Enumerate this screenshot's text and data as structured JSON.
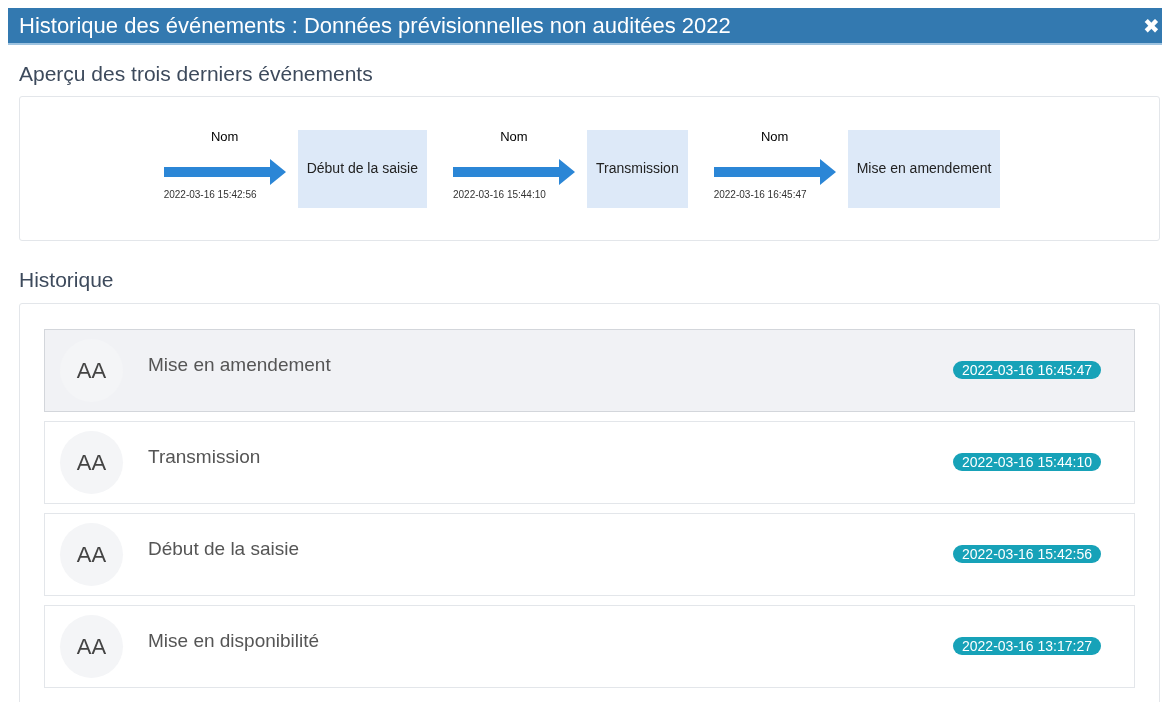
{
  "window": {
    "title": "Historique des événements : Données prévisionnelles non auditées 2022",
    "close": "✖"
  },
  "preview": {
    "heading": "Aperçu des trois derniers événements",
    "steps": [
      {
        "label": "Nom",
        "date": "2022-03-16 15:42:56",
        "event": "Début de la saisie"
      },
      {
        "label": "Nom",
        "date": "2022-03-16 15:44:10",
        "event": "Transmission"
      },
      {
        "label": "Nom",
        "date": "2022-03-16 16:45:47",
        "event": "Mise en amendement"
      }
    ]
  },
  "history": {
    "heading": "Historique",
    "items": [
      {
        "initials": "AA",
        "event": "Mise en amendement",
        "date": "2022-03-16 16:45:47",
        "highlighted": true
      },
      {
        "initials": "AA",
        "event": "Transmission",
        "date": "2022-03-16 15:44:10",
        "highlighted": false
      },
      {
        "initials": "AA",
        "event": "Début de la saisie",
        "date": "2022-03-16 15:42:56",
        "highlighted": false
      },
      {
        "initials": "AA",
        "event": "Mise en disponibilité",
        "date": "2022-03-16 13:17:27",
        "highlighted": false
      }
    ]
  }
}
